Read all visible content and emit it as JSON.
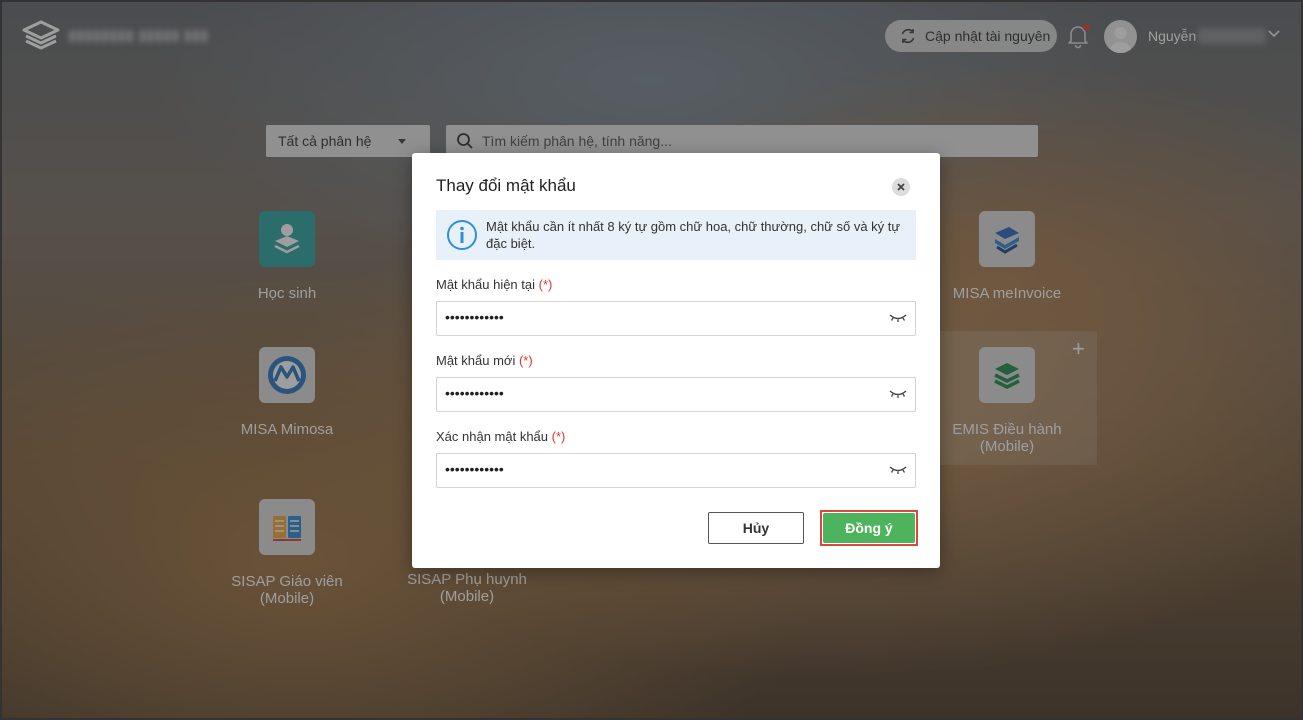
{
  "header": {
    "update_resources_label": "Cập nhật tài nguyên",
    "user_name": "Nguyễn"
  },
  "search": {
    "module_filter": "Tất cả phân hệ",
    "placeholder": "Tìm kiếm phân hệ, tính năng..."
  },
  "apps": [
    {
      "label": "Học sinh",
      "icon": "student-icon"
    },
    {
      "label": "MISA meInvoice",
      "icon": "meinvoice-icon"
    },
    {
      "label": "MISA Mimosa",
      "icon": "mimosa-icon"
    },
    {
      "label": "EMIS Điều hành (Mobile)",
      "icon": "emis-icon"
    },
    {
      "label": "SISAP Giáo viên (Mobile)",
      "icon": "sisap-teacher-icon"
    },
    {
      "label": "SISAP Phụ huynh (Mobile)",
      "icon": "sisap-parent-icon"
    }
  ],
  "dialog": {
    "title": "Thay đổi mật khẩu",
    "info": "Mật khẩu cần ít nhất 8 ký tự gồm chữ hoa, chữ thường, chữ số và ký tự đặc biệt.",
    "required_mark": "(*)",
    "fields": [
      {
        "label": "Mật khẩu hiện tại",
        "value": "••••••••••••"
      },
      {
        "label": "Mật khẩu mới",
        "value": "••••••••••••"
      },
      {
        "label": "Xác nhận mật khẩu",
        "value": "••••••••••••"
      }
    ],
    "cancel_label": "Hủy",
    "confirm_label": "Đồng ý"
  },
  "colors": {
    "confirm_button": "#4db35c",
    "highlight_border": "#e0443a",
    "required": "#e0352b",
    "info_bg": "#e8f1fa",
    "info_icon": "#2f8fd8"
  }
}
